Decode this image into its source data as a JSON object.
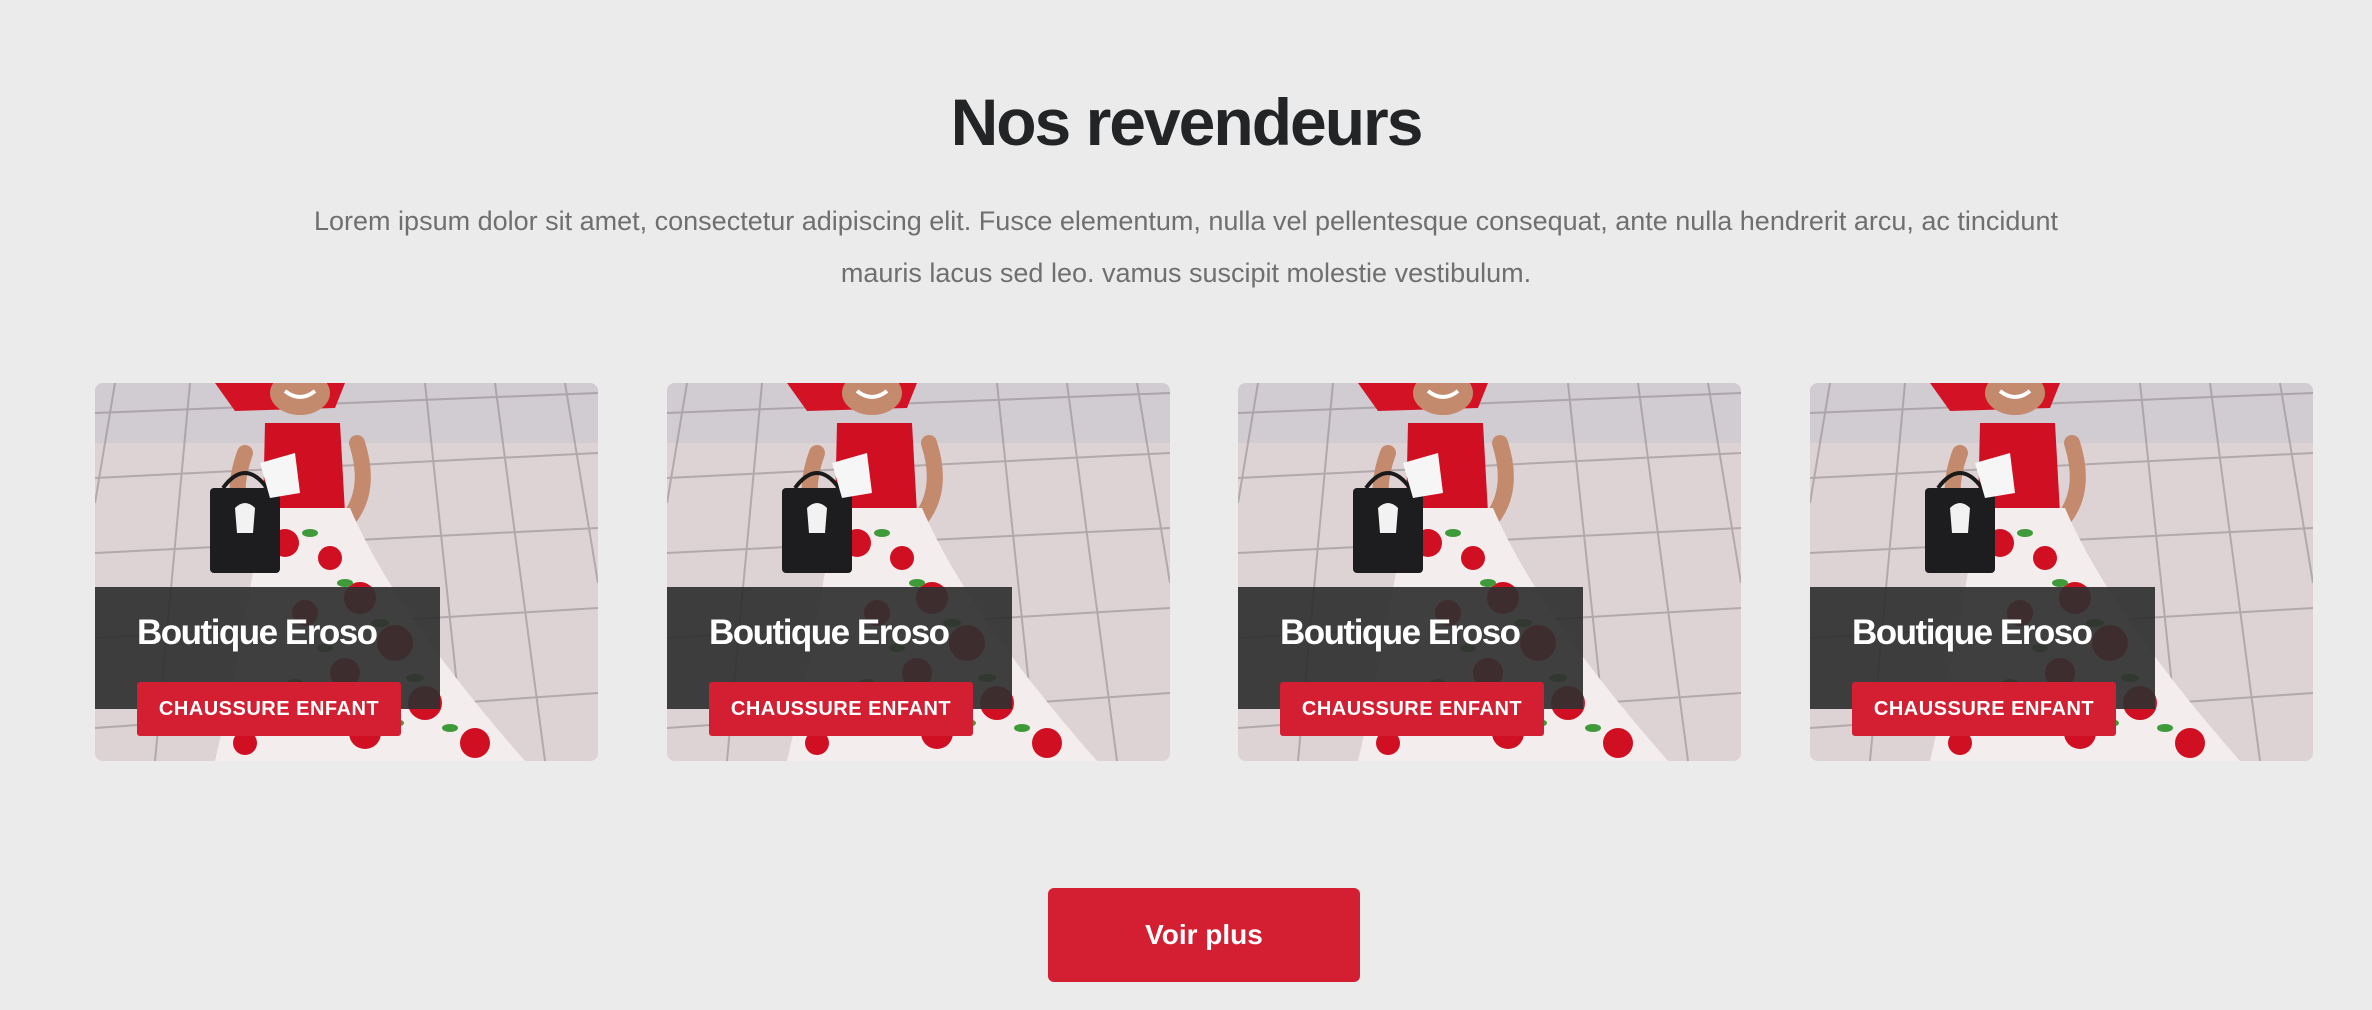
{
  "section": {
    "title": "Nos revendeurs",
    "intro": "Lorem ipsum dolor sit amet, consectetur adipiscing elit. Fusce elementum, nulla vel pellentesque consequat, ante nulla hendrerit arcu, ac tincidunt mauris lacus sed leo. vamus suscipit molestie vestibulum."
  },
  "cards": [
    {
      "title": "Boutique Eroso",
      "tag": "CHAUSSURE ENFANT"
    },
    {
      "title": "Boutique Eroso",
      "tag": "CHAUSSURE ENFANT"
    },
    {
      "title": "Boutique Eroso",
      "tag": "CHAUSSURE ENFANT"
    },
    {
      "title": "Boutique Eroso",
      "tag": "CHAUSSURE ENFANT"
    }
  ],
  "more_button": {
    "label": "Voir plus"
  },
  "colors": {
    "background": "#ebebeb",
    "accent": "#d41f32",
    "title": "#222426",
    "body_text": "#6f6f6f",
    "overlay": "#303030"
  }
}
